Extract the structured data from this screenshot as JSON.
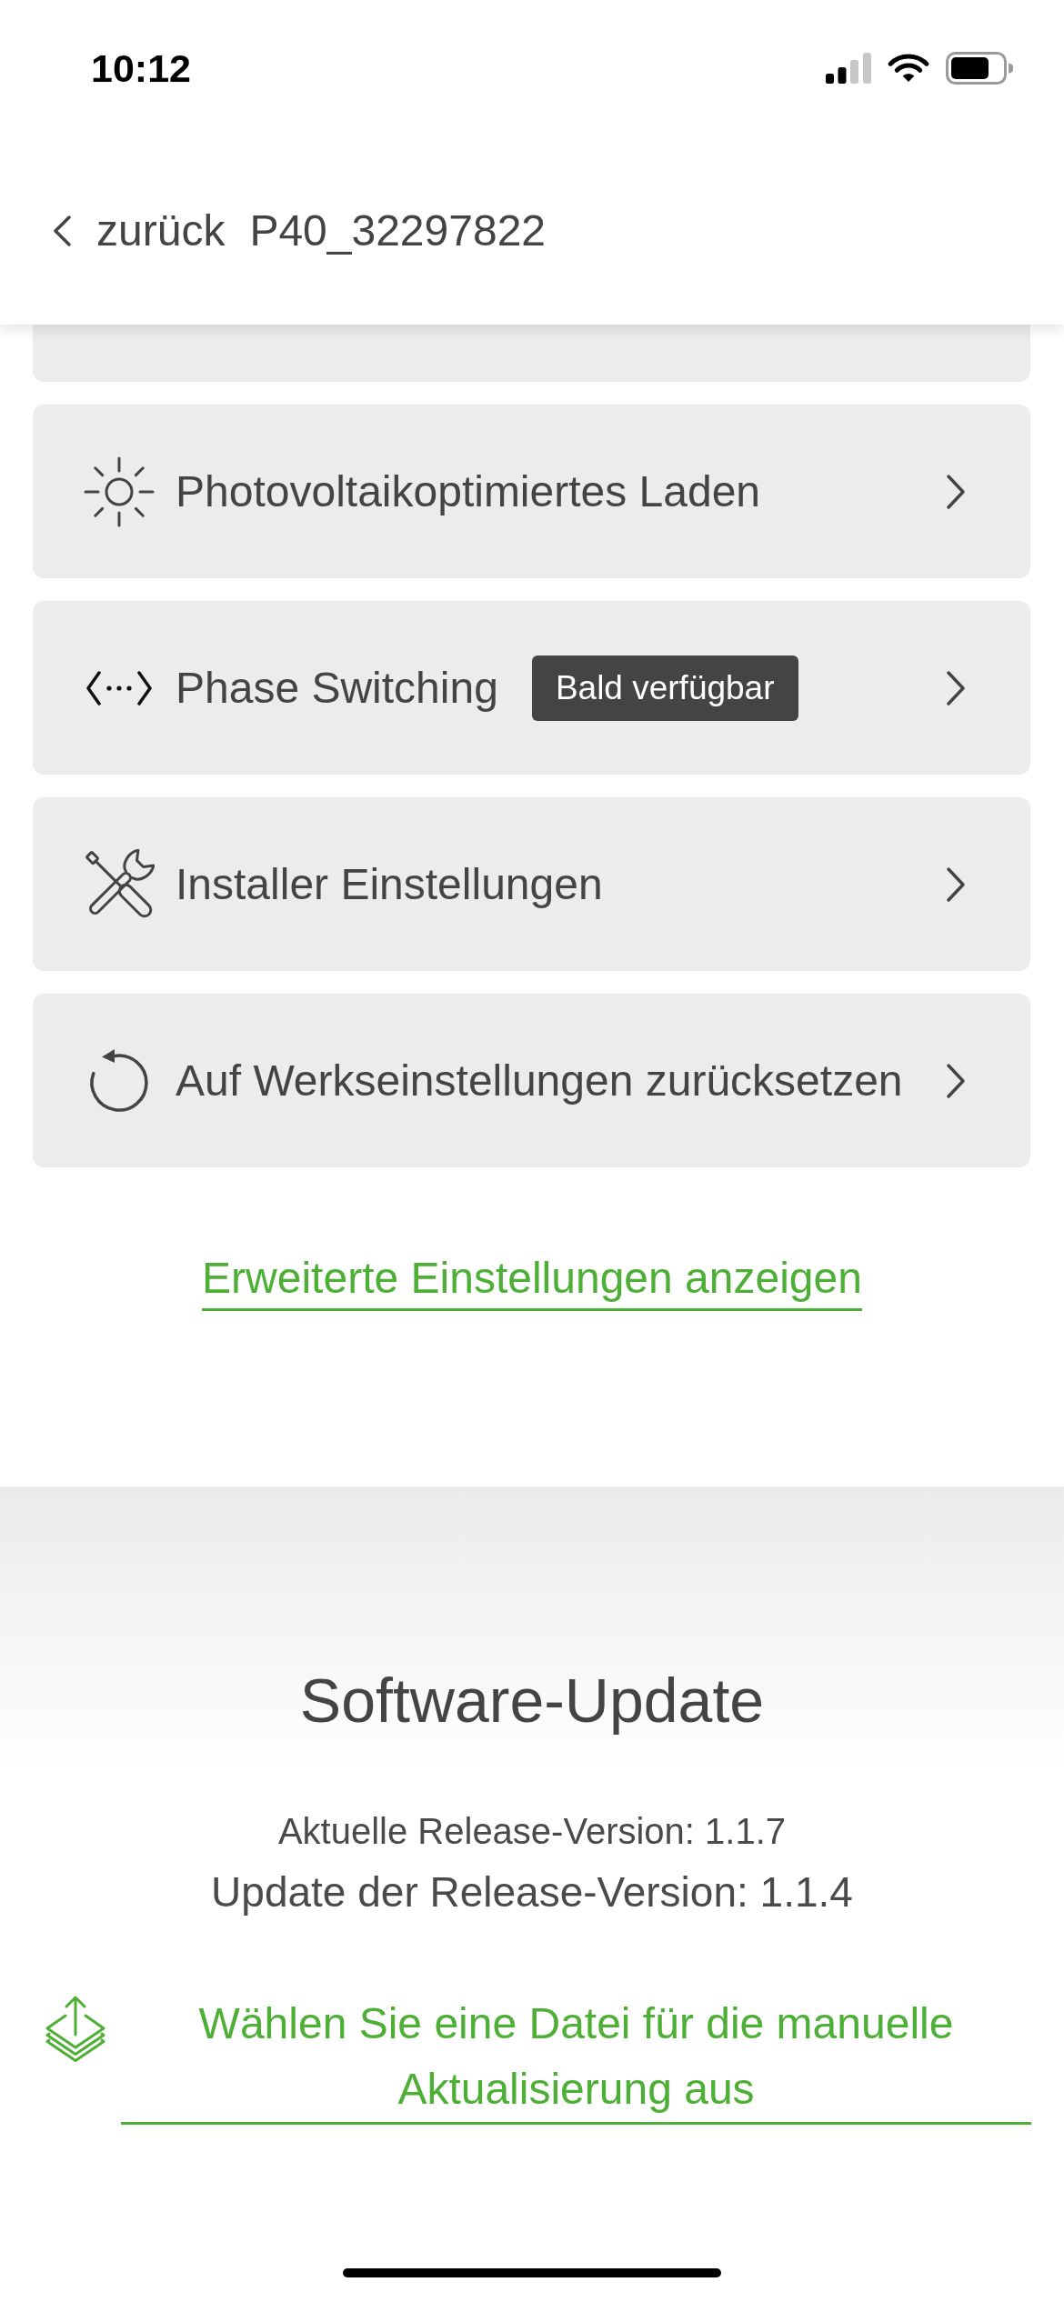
{
  "status_bar": {
    "time": "10:12"
  },
  "header": {
    "back_label": "zurück",
    "title": "P40_32297822"
  },
  "settings_items": [
    {
      "label": "Photovoltaikoptimiertes Laden"
    },
    {
      "label": "Phase Switching",
      "badge": "Bald verfügbar"
    },
    {
      "label": "Installer Einstellungen"
    },
    {
      "label": "Auf Werkseinstellungen zurücksetzen"
    }
  ],
  "advanced_settings_link": "Erweiterte Einstellungen anzeigen",
  "software_update": {
    "title": "Software-Update",
    "current_version": "Aktuelle Release-Version: 1.1.7",
    "update_version": "Update der Release-Version: 1.1.4",
    "manual_update_link": "Wählen Sie eine Datei für die manuelle Aktualisierung aus"
  }
}
